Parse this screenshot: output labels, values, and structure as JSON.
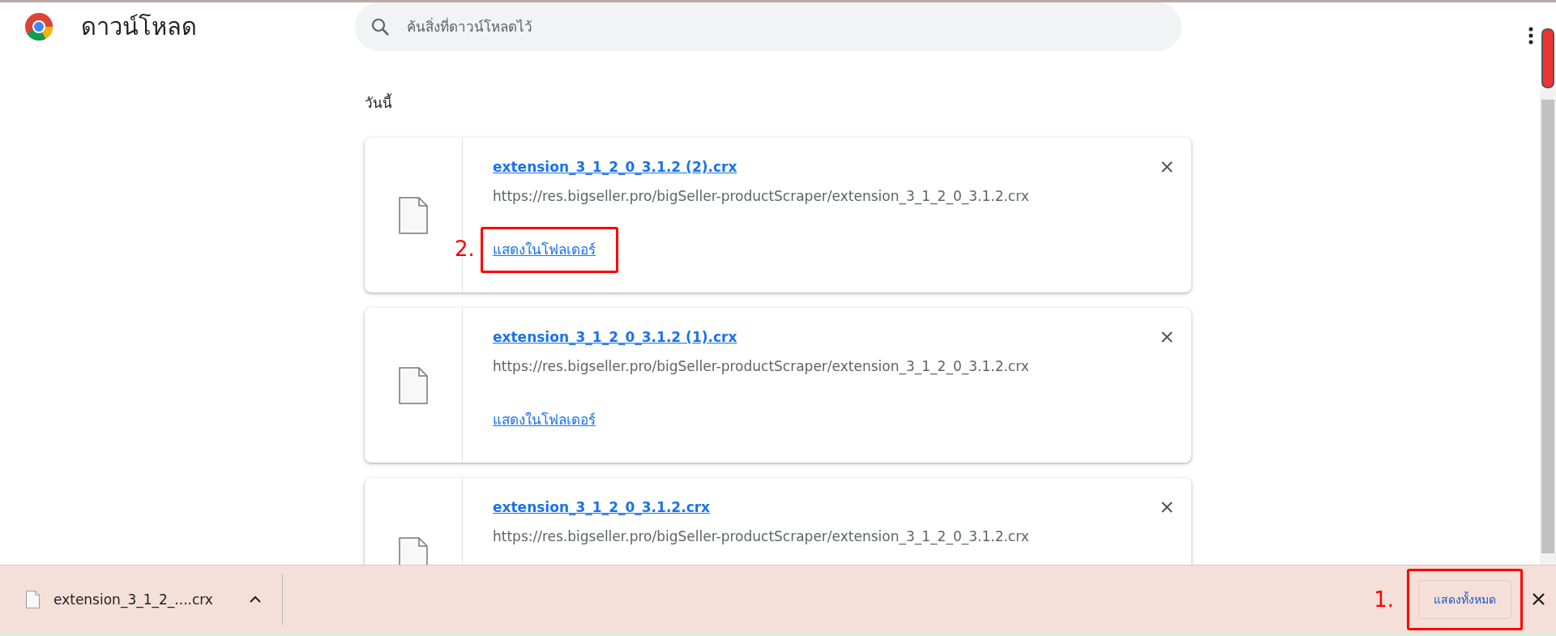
{
  "header": {
    "title": "ดาวน์โหลด",
    "search_placeholder": "ค้นสิ่งที่ดาวน์โหลดไว้"
  },
  "section_label": "วันนี้",
  "downloads": [
    {
      "filename": "extension_3_1_2_0_3.1.2 (2).crx",
      "url": "https://res.bigseller.pro/bigSeller-productScraper/extension_3_1_2_0_3.1.2.crx",
      "action": "แสดงในโฟลเดอร์",
      "annotation": "2."
    },
    {
      "filename": "extension_3_1_2_0_3.1.2 (1).crx",
      "url": "https://res.bigseller.pro/bigSeller-productScraper/extension_3_1_2_0_3.1.2.crx",
      "action": "แสดงในโฟลเดอร์"
    },
    {
      "filename": "extension_3_1_2_0_3.1.2.crx",
      "url": "https://res.bigseller.pro/bigSeller-productScraper/extension_3_1_2_0_3.1.2.crx"
    }
  ],
  "download_bar": {
    "item": "extension_3_1_2_....crx",
    "show_all": "แสดงทั้งหมด",
    "annotation": "1."
  }
}
